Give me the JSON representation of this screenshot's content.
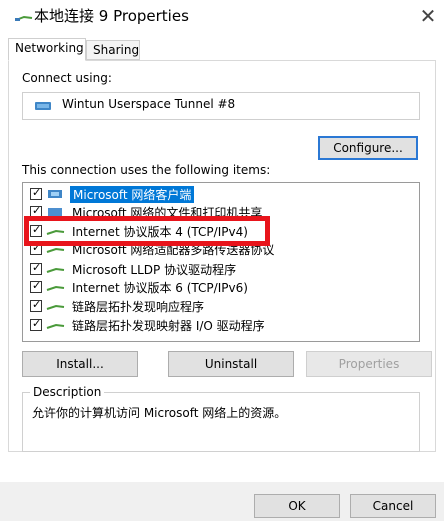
{
  "window": {
    "title": "本地连接 9 Properties",
    "close_symbol": "✕"
  },
  "tabs": [
    {
      "label": "Networking",
      "active": true
    },
    {
      "label": "Sharing",
      "active": false
    }
  ],
  "connect": {
    "label": "Connect using:",
    "adapter_name": "Wintun Userspace Tunnel #8",
    "adapter_icon": "network-adapter-icon",
    "configure_label": "Configure..."
  },
  "items": {
    "label": "This connection uses the following items:",
    "list": [
      {
        "label": "Microsoft 网络客户端",
        "checked": true,
        "icon": "client-icon",
        "selected": true
      },
      {
        "label": "Microsoft 网络的文件和打印机共享",
        "checked": true,
        "icon": "service-icon"
      },
      {
        "label": "Internet 协议版本 4 (TCP/IPv4)",
        "checked": true,
        "icon": "protocol-icon"
      },
      {
        "label": "Microsoft 网络适配器多路传送器协议",
        "checked": true,
        "icon": "protocol-icon"
      },
      {
        "label": "Microsoft LLDP 协议驱动程序",
        "checked": true,
        "icon": "protocol-icon"
      },
      {
        "label": "Internet 协议版本 6 (TCP/IPv6)",
        "checked": true,
        "icon": "protocol-icon"
      },
      {
        "label": "链路层拓扑发现响应程序",
        "checked": true,
        "icon": "protocol-icon"
      },
      {
        "label": "链路层拓扑发现映射器 I/O 驱动程序",
        "checked": true,
        "icon": "protocol-icon"
      }
    ]
  },
  "buttons": {
    "install": "Install...",
    "uninstall": "Uninstall",
    "properties": "Properties",
    "ok": "OK",
    "cancel": "Cancel"
  },
  "description": {
    "legend": "Description",
    "text": "允许你的计算机访问 Microsoft 网络上的资源。"
  },
  "colors": {
    "accent": "#0078d7",
    "highlight": "#e8141b"
  }
}
